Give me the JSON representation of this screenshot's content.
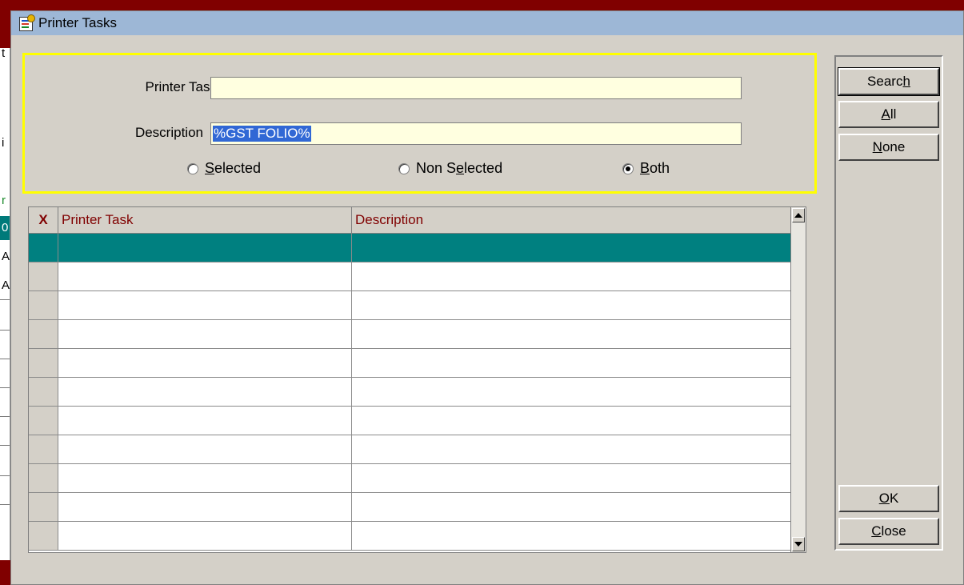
{
  "window": {
    "title": "Printer Tasks",
    "icon": "printer-tasks-icon"
  },
  "background_window": {
    "fragments": [
      "t",
      "i",
      "r",
      "0",
      "A",
      "A"
    ]
  },
  "search": {
    "printer_task_label": "Printer Task",
    "printer_task_value": "",
    "description_label": "Description",
    "description_value": "%GST FOLIO%",
    "radios": [
      {
        "label_pre": "",
        "accel": "S",
        "label_post": "elected",
        "checked": false
      },
      {
        "label_pre": "Non S",
        "accel": "e",
        "label_post": "lected",
        "checked": false
      },
      {
        "label_pre": "",
        "accel": "B",
        "label_post": "oth",
        "checked": true
      }
    ]
  },
  "grid": {
    "headers": {
      "select": "X",
      "printer_task": "Printer Task",
      "description": "Description"
    },
    "selected_row_color": "#008080",
    "rows": [
      {
        "printer_task": "",
        "description": "",
        "selected": true
      },
      {
        "printer_task": "",
        "description": ""
      },
      {
        "printer_task": "",
        "description": ""
      },
      {
        "printer_task": "",
        "description": ""
      },
      {
        "printer_task": "",
        "description": ""
      },
      {
        "printer_task": "",
        "description": ""
      },
      {
        "printer_task": "",
        "description": ""
      },
      {
        "printer_task": "",
        "description": ""
      },
      {
        "printer_task": "",
        "description": ""
      },
      {
        "printer_task": "",
        "description": ""
      },
      {
        "printer_task": "",
        "description": ""
      }
    ]
  },
  "buttons": {
    "search": {
      "pre": "Searc",
      "accel": "h",
      "post": ""
    },
    "all": {
      "pre": "",
      "accel": "A",
      "post": "ll"
    },
    "none": {
      "pre": "",
      "accel": "N",
      "post": "one"
    },
    "ok": {
      "pre": "",
      "accel": "O",
      "post": "K"
    },
    "close": {
      "pre": "",
      "accel": "C",
      "post": "lose"
    }
  },
  "colors": {
    "frame": "#800000",
    "titlebar": "#9db7d6",
    "field_bg": "#ffffe0",
    "group_border": "#ffff00",
    "header_text": "#800000"
  }
}
